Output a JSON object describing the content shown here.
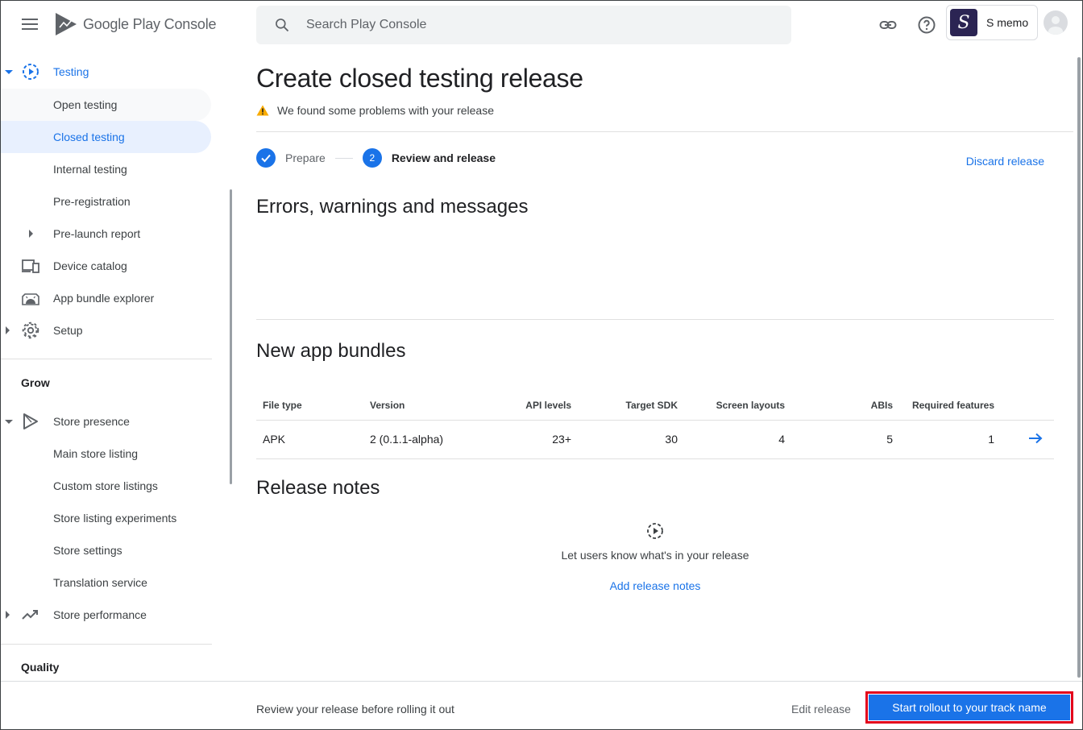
{
  "app": {
    "logo_text": "Google Play Console",
    "search_placeholder": "Search Play Console",
    "account_name": "S memo",
    "account_initial": "S"
  },
  "sidebar": {
    "items": [
      {
        "label": "Testing",
        "icon": "testing-icon",
        "state": "expanded-active"
      },
      {
        "label": "Open testing"
      },
      {
        "label": "Closed testing",
        "state": "selected"
      },
      {
        "label": "Internal testing"
      },
      {
        "label": "Pre-registration"
      },
      {
        "label": "Pre-launch report",
        "state": "collapsed"
      },
      {
        "label": "Device catalog",
        "icon": "devices-icon"
      },
      {
        "label": "App bundle explorer",
        "icon": "android-icon"
      },
      {
        "label": "Setup",
        "icon": "gear-icon",
        "state": "collapsed"
      }
    ],
    "grow_title": "Grow",
    "grow_items": [
      {
        "label": "Store presence",
        "icon": "play-outline-icon",
        "state": "expanded"
      },
      {
        "label": "Main store listing"
      },
      {
        "label": "Custom store listings"
      },
      {
        "label": "Store listing experiments"
      },
      {
        "label": "Store settings"
      },
      {
        "label": "Translation service"
      },
      {
        "label": "Store performance",
        "icon": "trending-up-icon",
        "state": "collapsed"
      }
    ],
    "quality_title": "Quality"
  },
  "main": {
    "title": "Create closed testing release",
    "warning": "We found some problems with your release",
    "steps": [
      {
        "number": "1",
        "label": "Prepare",
        "status": "done"
      },
      {
        "number": "2",
        "label": "Review and release",
        "status": "current"
      }
    ],
    "discard_label": "Discard release",
    "errors_heading": "Errors, warnings and messages",
    "bundles_heading": "New app bundles",
    "bundles_table": {
      "headers": [
        "File type",
        "Version",
        "API levels",
        "Target SDK",
        "Screen layouts",
        "ABIs",
        "Required features"
      ],
      "rows": [
        [
          "APK",
          "2 (0.1.1-alpha)",
          "23+",
          "30",
          "4",
          "5",
          "1"
        ]
      ]
    },
    "release_notes_heading": "Release notes",
    "release_notes_empty": "Let users know what's in your release",
    "add_release_notes": "Add release notes"
  },
  "footer": {
    "text": "Review your release before rolling it out",
    "edit_release": "Edit release",
    "rollout_button": "Start rollout to your track name"
  },
  "colors": {
    "accent": "#1a73e8",
    "highlight_outline": "#e3001b",
    "selected_bg": "#e8f0fe",
    "warning": "#f9ab00"
  }
}
